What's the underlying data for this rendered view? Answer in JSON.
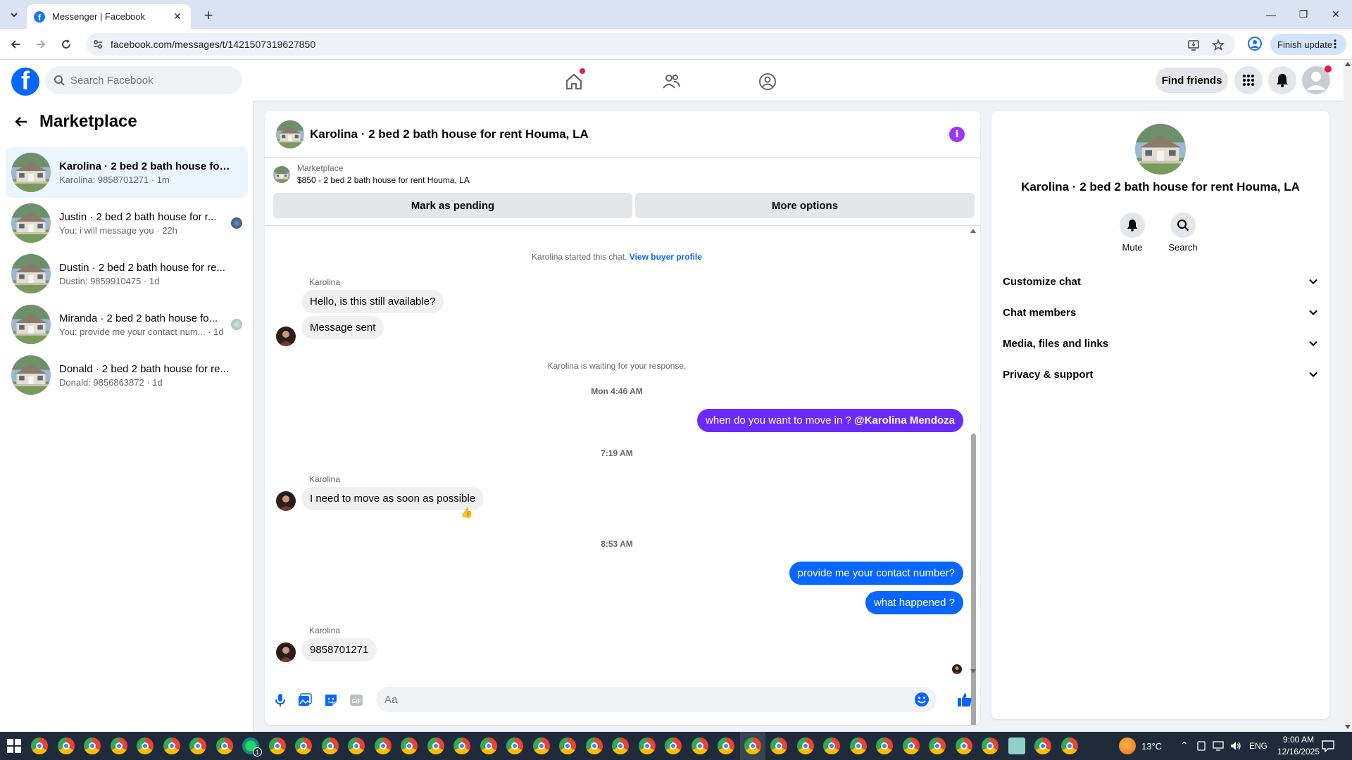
{
  "browser": {
    "tab_title": "Messenger | Facebook",
    "url": "facebook.com/messages/t/1421507319627850",
    "finish_update_label": "Finish update"
  },
  "header": {
    "search_placeholder": "Search Facebook",
    "find_friends_label": "Find friends"
  },
  "left_panel": {
    "title": "Marketplace",
    "conversations": [
      {
        "name": "Karolina · 2 bed 2 bath house for r...",
        "preview": "Karolina: 9858701271 · 1m",
        "active": true
      },
      {
        "name": "Justin · 2 bed 2 bath house for r...",
        "preview": "You: i will message you · 22h",
        "active": false
      },
      {
        "name": "Dustin · 2 bed 2 bath house for re...",
        "preview": "Dustin: 9859910475 · 1d",
        "active": false
      },
      {
        "name": "Miranda · 2 bed 2 bath house fo...",
        "preview": "You: provide me your contact num... · 1d",
        "active": false
      },
      {
        "name": "Donald · 2 bed 2 bath house for re...",
        "preview": "Donald: 9856863872 · 1d",
        "active": false
      }
    ]
  },
  "chat": {
    "title": "Karolina · 2 bed 2 bath house for rent Houma, LA",
    "marketplace_label": "Marketplace",
    "listing": "$850 - 2 bed 2 bath house for rent Houma, LA",
    "mark_pending_label": "Mark as pending",
    "more_options_label": "More options",
    "started_text": "Karolina started this chat.",
    "view_buyer_profile": "View buyer profile",
    "waiting_text": "Karolina is waiting for your response.",
    "sender": "Karolina",
    "messages": {
      "in1": "Hello, is this still available?",
      "in2": "Message sent",
      "time1": "Mon 4:46 AM",
      "out1_text": "when do you want to move in ? ",
      "out1_mention": "@Karolina Mendoza",
      "time2": "7:19 AM",
      "in3": "I need to move as soon as possible",
      "reaction": "👍",
      "time3": "8:53 AM",
      "out2": "provide me your contact number?",
      "out3": "what happened ?",
      "in4": "9858701271"
    },
    "composer_placeholder": "Aa"
  },
  "right_panel": {
    "title": "Karolina · 2 bed 2 bath house for rent Houma, LA",
    "mute_label": "Mute",
    "search_label": "Search",
    "sections": [
      "Customize chat",
      "Chat members",
      "Media, files and links",
      "Privacy & support"
    ]
  },
  "taskbar": {
    "temperature": "13°C",
    "language": "ENG",
    "time": "9:00 AM",
    "date": "12/16/2025",
    "badge_count": "1"
  },
  "colors": {
    "fb_blue": "#0866ff",
    "outgoing_purple": "#6b2bff",
    "info_purple": "#a033ff",
    "active_row": "#ebf5ff"
  }
}
